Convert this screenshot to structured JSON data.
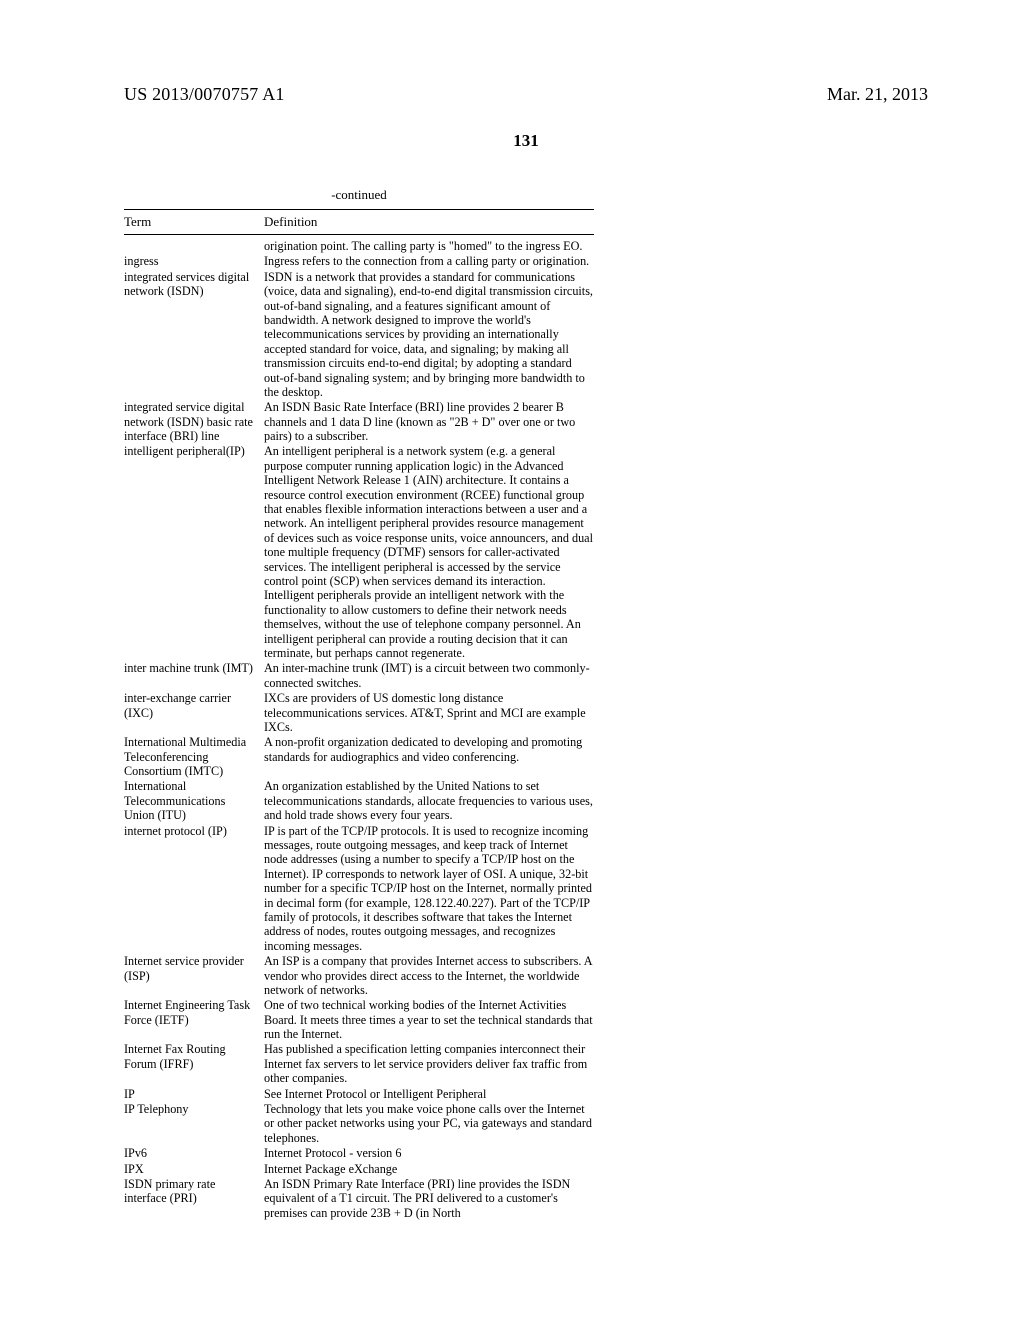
{
  "header": {
    "pubnum": "US 2013/0070757 A1",
    "pubdate": "Mar. 21, 2013"
  },
  "pagenum": "131",
  "table": {
    "continued": "-continued",
    "head_term": "Term",
    "head_def": "Definition",
    "rows": [
      {
        "term": "",
        "def": "origination point. The calling party is \"homed\" to the ingress EO."
      },
      {
        "term": "ingress",
        "def": "Ingress refers to the connection from a calling party or origination."
      },
      {
        "term": "integrated services digital network (ISDN)",
        "def": "ISDN is a network that provides a standard for communications (voice, data and signaling), end-to-end digital transmission circuits, out-of-band signaling, and a features significant amount of bandwidth. A network designed to improve the world's telecommunications services by providing an internationally accepted standard for voice, data, and signaling; by making all transmission circuits end-to-end digital; by adopting a standard out-of-band signaling system; and by bringing more bandwidth to the desktop."
      },
      {
        "term": "integrated service digital network (ISDN) basic rate interface (BRI) line",
        "def": "An ISDN Basic Rate Interface (BRI) line provides 2 bearer B channels and 1 data D line (known as \"2B + D\" over one or two pairs) to a subscriber."
      },
      {
        "term": "intelligent peripheral(IP)",
        "def": "An intelligent peripheral is a network system (e.g. a general purpose computer running application logic) in the Advanced Intelligent Network Release 1 (AIN) architecture. It contains a resource control execution environment (RCEE) functional group that enables flexible information interactions between a user and a network. An intelligent peripheral provides resource management of devices such as voice response units, voice announcers, and dual tone multiple frequency (DTMF) sensors for caller-activated services. The intelligent peripheral is accessed by the service control point (SCP) when services demand its interaction. Intelligent peripherals provide an intelligent network with the functionality to allow customers to define their network needs themselves, without the use of telephone company personnel. An intelligent peripheral can provide a routing decision that it can terminate, but perhaps cannot regenerate."
      },
      {
        "term": "inter machine trunk (IMT)",
        "def": "An inter-machine trunk (IMT) is a circuit between two commonly-connected switches."
      },
      {
        "term": "inter-exchange carrier (IXC)",
        "def": "IXCs are providers of US domestic long distance telecommunications services. AT&T, Sprint and MCI are example IXCs."
      },
      {
        "term": "International Multimedia Teleconferencing Consortium (IMTC)",
        "def": "A non-profit organization dedicated to developing and promoting standards for audiographics and video conferencing."
      },
      {
        "term": "International Telecommunications Union (ITU)",
        "def": "An organization established by the United Nations to set telecommunications standards, allocate frequencies to various uses, and hold trade shows every four years."
      },
      {
        "term": "internet protocol (IP)",
        "def": "IP is part of the TCP/IP protocols. It is used to recognize incoming messages, route outgoing messages, and keep track of Internet node addresses (using a number to specify a TCP/IP host on the Internet). IP corresponds to network layer of OSI. A unique, 32-bit number for a specific TCP/IP host on the Internet, normally printed in decimal form (for example, 128.122.40.227). Part of the TCP/IP family of protocols, it describes software that takes the Internet address of nodes, routes outgoing messages, and recognizes incoming messages."
      },
      {
        "term": "Internet service provider (ISP)",
        "def": "An ISP is a company that provides Internet access to subscribers. A vendor who provides direct access to the Internet, the worldwide network of networks."
      },
      {
        "term": "Internet Engineering Task Force (IETF)",
        "def": "One of two technical working bodies of the Internet Activities Board. It meets three times a year to set the technical standards that run the Internet."
      },
      {
        "term": "Internet Fax Routing Forum (IFRF)",
        "def": "Has published a specification letting companies interconnect their Internet fax servers to let service providers deliver fax traffic from other companies."
      },
      {
        "term": "IP",
        "def": "See Internet Protocol or Intelligent Peripheral"
      },
      {
        "term": "IP Telephony",
        "def": "Technology that lets you make voice phone calls over the Internet or other packet networks using your PC, via gateways and standard telephones."
      },
      {
        "term": "IPv6",
        "def": "Internet Protocol - version 6"
      },
      {
        "term": "IPX",
        "def": "Internet Package eXchange"
      },
      {
        "term": "ISDN primary rate interface (PRI)",
        "def": "An ISDN Primary Rate Interface (PRI) line provides the ISDN equivalent of a T1 circuit. The PRI delivered to a customer's premises can provide 23B + D (in North"
      }
    ]
  }
}
